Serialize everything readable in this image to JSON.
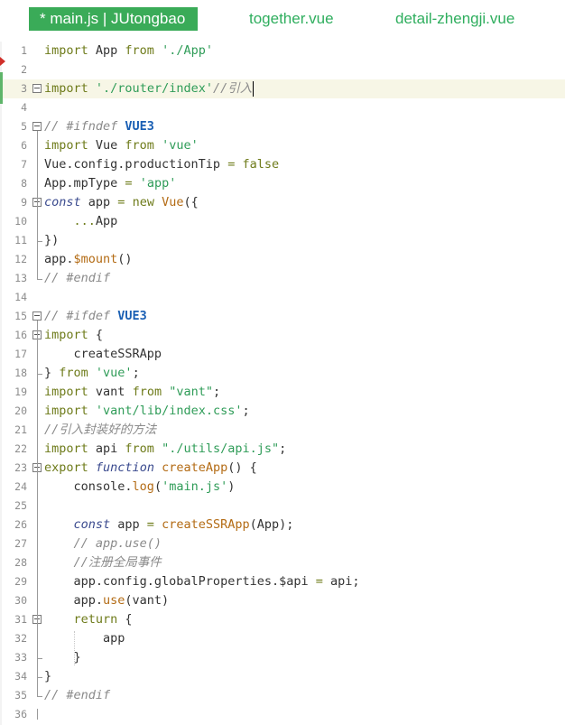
{
  "tabs": [
    {
      "label": "* main.js | JUtongbao",
      "active": true
    },
    {
      "label": "together.vue",
      "active": false
    },
    {
      "label": "detail-zhengji.vue",
      "active": false
    }
  ],
  "colors": {
    "active_tab_bg": "#3aab58",
    "tab_text": "#2fae5e",
    "keyword": "#6e7b1a",
    "string": "#2f9c58",
    "comment": "#8a8a8a"
  },
  "lines": [
    {
      "n": "1",
      "tokens": [
        [
          "kw",
          "import"
        ],
        [
          "p",
          " App "
        ],
        [
          "kw",
          "from"
        ],
        [
          "p",
          " "
        ],
        [
          "str",
          "'./App'"
        ]
      ]
    },
    {
      "n": "2",
      "tokens": []
    },
    {
      "n": "3",
      "fold": true,
      "highlight": true,
      "cursor": true,
      "tokens": [
        [
          "kw",
          "import"
        ],
        [
          "p",
          " "
        ],
        [
          "str",
          "'./router/index'"
        ],
        [
          "cm",
          "//引入"
        ]
      ]
    },
    {
      "n": "4",
      "tokens": []
    },
    {
      "n": "5",
      "fold": true,
      "tokens": [
        [
          "cm",
          "// #ifndef "
        ],
        [
          "mac",
          "VUE3"
        ]
      ]
    },
    {
      "n": "6",
      "tokens": [
        [
          "kw",
          "import"
        ],
        [
          "p",
          " Vue "
        ],
        [
          "kw",
          "from"
        ],
        [
          "p",
          " "
        ],
        [
          "str",
          "'vue'"
        ]
      ]
    },
    {
      "n": "7",
      "tokens": [
        [
          "p",
          "Vue.config.productionTip "
        ],
        [
          "kw",
          "="
        ],
        [
          "p",
          " "
        ],
        [
          "kw",
          "false"
        ]
      ]
    },
    {
      "n": "8",
      "tokens": [
        [
          "p",
          "App.mpType "
        ],
        [
          "kw",
          "="
        ],
        [
          "p",
          " "
        ],
        [
          "str",
          "'app'"
        ]
      ]
    },
    {
      "n": "9",
      "fold": true,
      "tokens": [
        [
          "kw2",
          "const"
        ],
        [
          "p",
          " app "
        ],
        [
          "kw",
          "="
        ],
        [
          "p",
          " "
        ],
        [
          "kw",
          "new"
        ],
        [
          "p",
          " "
        ],
        [
          "fn",
          "Vue"
        ],
        [
          "p",
          "({"
        ]
      ]
    },
    {
      "n": "10",
      "tokens": [
        [
          "p",
          "    "
        ],
        [
          "kw",
          "..."
        ],
        [
          "p",
          "App"
        ]
      ]
    },
    {
      "n": "11",
      "tokens": [
        [
          "p",
          "})"
        ]
      ]
    },
    {
      "n": "12",
      "tokens": [
        [
          "p",
          "app."
        ],
        [
          "fn",
          "$mount"
        ],
        [
          "p",
          "()"
        ]
      ]
    },
    {
      "n": "13",
      "tokens": [
        [
          "cm",
          "// #endif"
        ]
      ]
    },
    {
      "n": "14",
      "tokens": []
    },
    {
      "n": "15",
      "fold": true,
      "tokens": [
        [
          "cm",
          "// #ifdef "
        ],
        [
          "mac",
          "VUE3"
        ]
      ]
    },
    {
      "n": "16",
      "fold": true,
      "tokens": [
        [
          "kw",
          "import"
        ],
        [
          "p",
          " {"
        ]
      ]
    },
    {
      "n": "17",
      "tokens": [
        [
          "p",
          "    createSSRApp"
        ]
      ]
    },
    {
      "n": "18",
      "tokens": [
        [
          "p",
          "} "
        ],
        [
          "kw",
          "from"
        ],
        [
          "p",
          " "
        ],
        [
          "str",
          "'vue'"
        ],
        [
          "p",
          ";"
        ]
      ]
    },
    {
      "n": "19",
      "tokens": [
        [
          "kw",
          "import"
        ],
        [
          "p",
          " vant "
        ],
        [
          "kw",
          "from"
        ],
        [
          "p",
          " "
        ],
        [
          "str",
          "\"vant\""
        ],
        [
          "p",
          ";"
        ]
      ]
    },
    {
      "n": "20",
      "tokens": [
        [
          "kw",
          "import"
        ],
        [
          "p",
          " "
        ],
        [
          "str",
          "'vant/lib/index.css'"
        ],
        [
          "p",
          ";"
        ]
      ]
    },
    {
      "n": "21",
      "tokens": [
        [
          "cm",
          "//引入封装好的方法"
        ]
      ]
    },
    {
      "n": "22",
      "tokens": [
        [
          "kw",
          "import"
        ],
        [
          "p",
          " api "
        ],
        [
          "kw",
          "from"
        ],
        [
          "p",
          " "
        ],
        [
          "str",
          "\"./utils/api.js\""
        ],
        [
          "p",
          ";"
        ]
      ]
    },
    {
      "n": "23",
      "fold": true,
      "tokens": [
        [
          "kw",
          "export"
        ],
        [
          "p",
          " "
        ],
        [
          "kw2",
          "function"
        ],
        [
          "p",
          " "
        ],
        [
          "fn",
          "createApp"
        ],
        [
          "p",
          "() {"
        ]
      ]
    },
    {
      "n": "24",
      "tokens": [
        [
          "p",
          "    console."
        ],
        [
          "fn",
          "log"
        ],
        [
          "p",
          "("
        ],
        [
          "str",
          "'main.js'"
        ],
        [
          "p",
          ")"
        ]
      ]
    },
    {
      "n": "25",
      "tokens": []
    },
    {
      "n": "26",
      "tokens": [
        [
          "p",
          "    "
        ],
        [
          "kw2",
          "const"
        ],
        [
          "p",
          " app "
        ],
        [
          "kw",
          "="
        ],
        [
          "p",
          " "
        ],
        [
          "fn",
          "createSSRApp"
        ],
        [
          "p",
          "(App);"
        ]
      ]
    },
    {
      "n": "27",
      "tokens": [
        [
          "p",
          "    "
        ],
        [
          "cm",
          "// app.use()"
        ]
      ]
    },
    {
      "n": "28",
      "tokens": [
        [
          "p",
          "    "
        ],
        [
          "cm",
          "//注册全局事件"
        ]
      ]
    },
    {
      "n": "29",
      "tokens": [
        [
          "p",
          "    app.config.globalProperties.$api "
        ],
        [
          "kw",
          "="
        ],
        [
          "p",
          " api;"
        ]
      ]
    },
    {
      "n": "30",
      "tokens": [
        [
          "p",
          "    app."
        ],
        [
          "fn",
          "use"
        ],
        [
          "p",
          "(vant)"
        ]
      ]
    },
    {
      "n": "31",
      "fold": true,
      "tokens": [
        [
          "p",
          "    "
        ],
        [
          "kw",
          "return"
        ],
        [
          "p",
          " {"
        ]
      ]
    },
    {
      "n": "32",
      "tokens": [
        [
          "p",
          "        app"
        ]
      ]
    },
    {
      "n": "33",
      "tokens": [
        [
          "p",
          "    }"
        ]
      ]
    },
    {
      "n": "34",
      "tokens": [
        [
          "p",
          "}"
        ]
      ]
    },
    {
      "n": "35",
      "tokens": [
        [
          "cm",
          "// #endif"
        ]
      ]
    },
    {
      "n": "36",
      "tokens": []
    }
  ]
}
